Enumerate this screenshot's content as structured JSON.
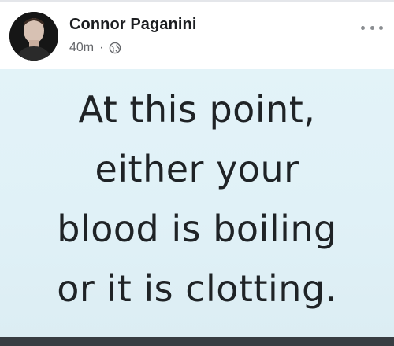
{
  "post": {
    "author_name": "Connor Paganini",
    "timestamp": "40m",
    "separator": "·",
    "audience_icon": "globe-icon",
    "more_icon": "more-horizontal-icon"
  },
  "image_text": {
    "line1": "At this point,",
    "line2": "either your",
    "line3": "blood is boiling",
    "line4": "or it is clotting."
  },
  "colors": {
    "image_background": "#e1f2f8",
    "text_dark": "#1c1e21",
    "meta_gray": "#65676b",
    "bottom_bar": "#383d42"
  }
}
